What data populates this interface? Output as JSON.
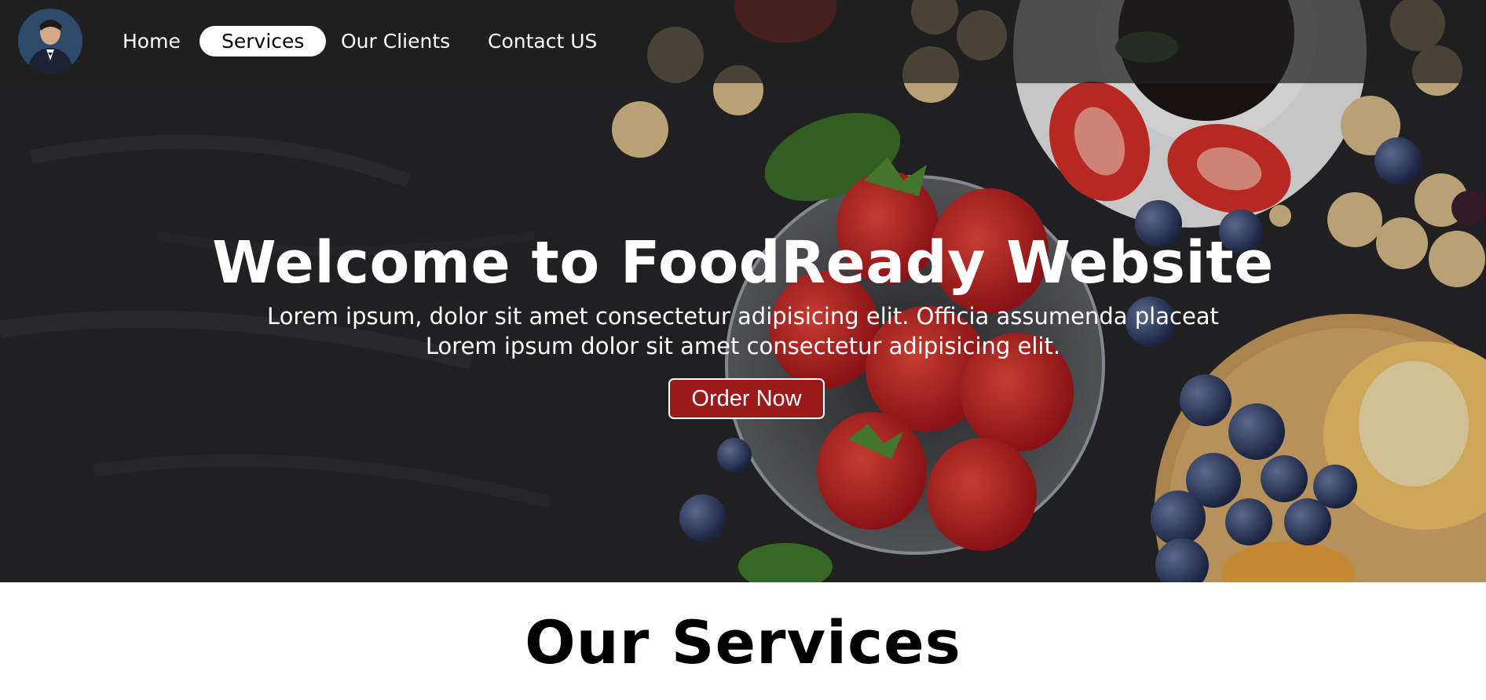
{
  "nav": {
    "avatar_icon": "profile-photo",
    "items": [
      {
        "label": "Home",
        "active": false
      },
      {
        "label": "Services",
        "active": true
      },
      {
        "label": "Our Clients",
        "active": false
      },
      {
        "label": "Contact US",
        "active": false
      }
    ]
  },
  "hero": {
    "title": "Welcome to FoodReady Website",
    "line1": "Lorem ipsum, dolor sit amet consectetur adipisicing elit. Officia assumenda placeat",
    "line2": "Lorem ipsum dolor sit amet consectetur adipisicing elit.",
    "order_button": "Order Now"
  },
  "services": {
    "title": "Our Services"
  },
  "colors": {
    "accent": "#9b1b1b",
    "nav_background": "#1e1e20",
    "hero_background": "#242426"
  }
}
